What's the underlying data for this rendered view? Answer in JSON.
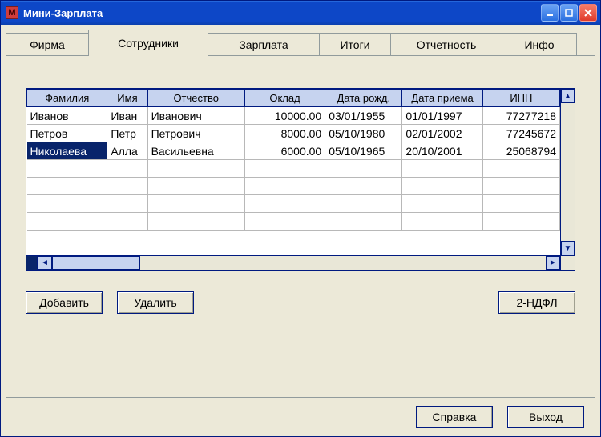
{
  "window": {
    "title": "Мини-Зарплата",
    "icon_text": "M"
  },
  "tabs": [
    {
      "label": "Фирма",
      "width": 104
    },
    {
      "label": "Сотрудники",
      "width": 150
    },
    {
      "label": "Зарплата",
      "width": 140
    },
    {
      "label": "Итоги",
      "width": 90
    },
    {
      "label": "Отчетность",
      "width": 140
    },
    {
      "label": "Инфо",
      "width": 94
    }
  ],
  "active_tab_index": 1,
  "grid": {
    "columns": [
      {
        "label": "Фамилия",
        "width": 96,
        "align": "left"
      },
      {
        "label": "Имя",
        "width": 48,
        "align": "left"
      },
      {
        "label": "Отчество",
        "width": 116,
        "align": "left"
      },
      {
        "label": "Оклад",
        "width": 96,
        "align": "right"
      },
      {
        "label": "Дата рожд.",
        "width": 92,
        "align": "left"
      },
      {
        "label": "Дата приема",
        "width": 96,
        "align": "left"
      },
      {
        "label": "ИНН",
        "width": 92,
        "align": "right"
      }
    ],
    "rows": [
      {
        "cells": [
          "Иванов",
          "Иван",
          "Иванович",
          "10000.00",
          "03/01/1955",
          "01/01/1997",
          "77277218"
        ],
        "selected": false
      },
      {
        "cells": [
          "Петров",
          "Петр",
          "Петрович",
          "8000.00",
          "05/10/1980",
          "02/01/2002",
          "77245672"
        ],
        "selected": false
      },
      {
        "cells": [
          "Николаева",
          "Алла",
          "Васильевна",
          "6000.00",
          "05/10/1965",
          "20/10/2001",
          "25068794"
        ],
        "selected": true
      }
    ],
    "empty_rows": 4
  },
  "buttons": {
    "add": "Добавить",
    "delete": "Удалить",
    "ndfl": "2-НДФЛ",
    "help": "Справка",
    "exit": "Выход"
  }
}
